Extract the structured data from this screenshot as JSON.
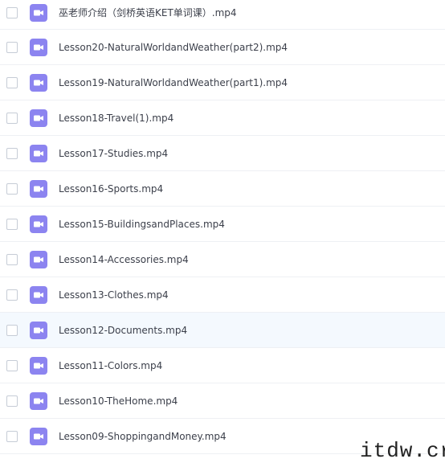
{
  "icons": {
    "file": "video-file-icon",
    "checkbox": "checkbox-icon"
  },
  "colors": {
    "icon": "#8c84f0",
    "row_highlight": "#f4f9fe",
    "text": "#3b3f4a"
  },
  "files": [
    {
      "name": "巫老师介绍（剑桥英语KET单词课）.mp4"
    },
    {
      "name": "Lesson20-NaturalWorldandWeather(part2).mp4"
    },
    {
      "name": "Lesson19-NaturalWorldandWeather(part1).mp4"
    },
    {
      "name": "Lesson18-Travel(1).mp4"
    },
    {
      "name": "Lesson17-Studies.mp4"
    },
    {
      "name": "Lesson16-Sports.mp4"
    },
    {
      "name": "Lesson15-BuildingsandPlaces.mp4"
    },
    {
      "name": "Lesson14-Accessories.mp4"
    },
    {
      "name": "Lesson13-Clothes.mp4"
    },
    {
      "name": "Lesson12-Documents.mp4"
    },
    {
      "name": "Lesson11-Colors.mp4"
    },
    {
      "name": "Lesson10-TheHome.mp4"
    },
    {
      "name": "Lesson09-ShoppingandMoney.mp4"
    }
  ],
  "watermark": "itdw.cr"
}
